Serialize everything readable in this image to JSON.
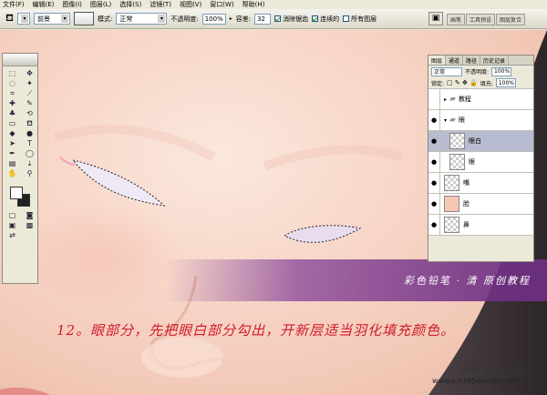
{
  "menubar": [
    "文件(F)",
    "编辑(E)",
    "图像(I)",
    "图层(L)",
    "选择(S)",
    "滤镜(T)",
    "视图(V)",
    "窗口(W)",
    "帮助(H)"
  ],
  "options": {
    "preset": "前景",
    "mode_label": "模式:",
    "mode_value": "正常",
    "opacity_label": "不透明度:",
    "opacity_value": "100%",
    "tolerance_label": "容差:",
    "tolerance_value": "32",
    "antialias_label": "消除锯齿",
    "contiguous_label": "连续的",
    "all_layers_label": "所有图层"
  },
  "wells": [
    "画笔",
    "工具预设",
    "图层复合"
  ],
  "layers_panel": {
    "tabs": [
      "图层",
      "通道",
      "路径",
      "历史记录"
    ],
    "blend_mode": "正常",
    "opacity_label": "不透明度:",
    "opacity_value": "100%",
    "lock_label": "锁定:",
    "fill_label": "填充:",
    "fill_value": "100%",
    "layers": [
      {
        "name": "教程",
        "type": "group",
        "visible": false
      },
      {
        "name": "眼",
        "type": "group",
        "visible": true
      },
      {
        "name": "眼白",
        "type": "layer",
        "visible": true,
        "selected": true
      },
      {
        "name": "眼",
        "type": "layer",
        "visible": true
      },
      {
        "name": "嘴",
        "type": "layer",
        "visible": true
      },
      {
        "name": "脸",
        "type": "layer",
        "visible": true
      },
      {
        "name": "鼻",
        "type": "layer",
        "visible": true
      }
    ]
  },
  "banner_text": "彩色铅笔 · 清 原创教程",
  "caption": "12。眼部分，先把眼白部分勾出，开新层适当羽化填充颜色。",
  "site_name": "中国·365设计网",
  "site_url": "www.jcn365design.com",
  "colors": {
    "skin": "#f7d6c8",
    "eye_white": "#efe9f6",
    "banner": "#86429a",
    "caption": "#d11a2a"
  }
}
